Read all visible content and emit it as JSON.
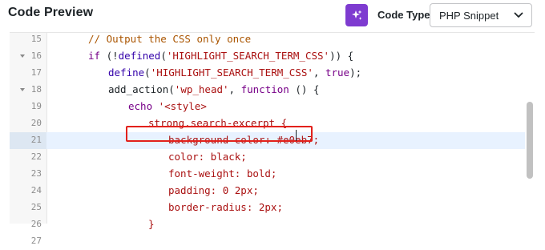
{
  "header": {
    "title": "Code Preview",
    "ai_button_icon": "sparkles-icon",
    "code_type_label": "Code Type",
    "code_type_value": "PHP Snippet",
    "chevron_icon": "chevron-down-icon"
  },
  "editor": {
    "lines": [
      {
        "num": "15",
        "fold": false,
        "indent": 2,
        "tokens": [
          {
            "t": "// Output the CSS only once",
            "c": "comment"
          }
        ]
      },
      {
        "num": "16",
        "fold": true,
        "indent": 2,
        "tokens": [
          {
            "t": "if",
            "c": "kw"
          },
          {
            "t": " (!",
            "c": ""
          },
          {
            "t": "defined",
            "c": "builtin"
          },
          {
            "t": "(",
            "c": ""
          },
          {
            "t": "'HIGHLIGHT_SEARCH_TERM_CSS'",
            "c": "str"
          },
          {
            "t": ")) {",
            "c": ""
          }
        ]
      },
      {
        "num": "17",
        "fold": false,
        "indent": 3,
        "tokens": [
          {
            "t": "define",
            "c": "builtin"
          },
          {
            "t": "(",
            "c": ""
          },
          {
            "t": "'HIGHLIGHT_SEARCH_TERM_CSS'",
            "c": "str"
          },
          {
            "t": ", ",
            "c": ""
          },
          {
            "t": "true",
            "c": "kw"
          },
          {
            "t": ");",
            "c": ""
          }
        ]
      },
      {
        "num": "18",
        "fold": true,
        "indent": 3,
        "tokens": [
          {
            "t": "add_action(",
            "c": ""
          },
          {
            "t": "'wp_head'",
            "c": "str"
          },
          {
            "t": ", ",
            "c": ""
          },
          {
            "t": "function",
            "c": "kw"
          },
          {
            "t": " () {",
            "c": ""
          }
        ]
      },
      {
        "num": "19",
        "fold": false,
        "indent": 4,
        "tokens": [
          {
            "t": "echo",
            "c": "kw"
          },
          {
            "t": " '<style>",
            "c": "str"
          }
        ]
      },
      {
        "num": "20",
        "fold": false,
        "indent": 5,
        "tokens": [
          {
            "t": "strong.search-excerpt {",
            "c": "str"
          }
        ]
      },
      {
        "num": "21",
        "fold": false,
        "indent": 6,
        "active": true,
        "tokens": [
          {
            "t": "background-color: #e0eb7;",
            "c": "str"
          }
        ]
      },
      {
        "num": "22",
        "fold": false,
        "indent": 6,
        "tokens": [
          {
            "t": "color: black;",
            "c": "str"
          }
        ]
      },
      {
        "num": "23",
        "fold": false,
        "indent": 6,
        "tokens": [
          {
            "t": "font-weight: bold;",
            "c": "str"
          }
        ]
      },
      {
        "num": "24",
        "fold": false,
        "indent": 6,
        "tokens": [
          {
            "t": "padding: 0 2px;",
            "c": "str"
          }
        ]
      },
      {
        "num": "25",
        "fold": false,
        "indent": 6,
        "tokens": [
          {
            "t": "border-radius: 2px;",
            "c": "str"
          }
        ]
      },
      {
        "num": "26",
        "fold": false,
        "indent": 5,
        "tokens": [
          {
            "t": "}",
            "c": "str"
          }
        ]
      },
      {
        "num": "27",
        "fold": false,
        "indent": 4,
        "tokens": [
          {
            "t": "",
            "c": ""
          }
        ]
      }
    ]
  },
  "colors": {
    "accent": "#7e3bd0",
    "highlight_box": "#e2211c",
    "active_line": "#e8f2ff"
  }
}
